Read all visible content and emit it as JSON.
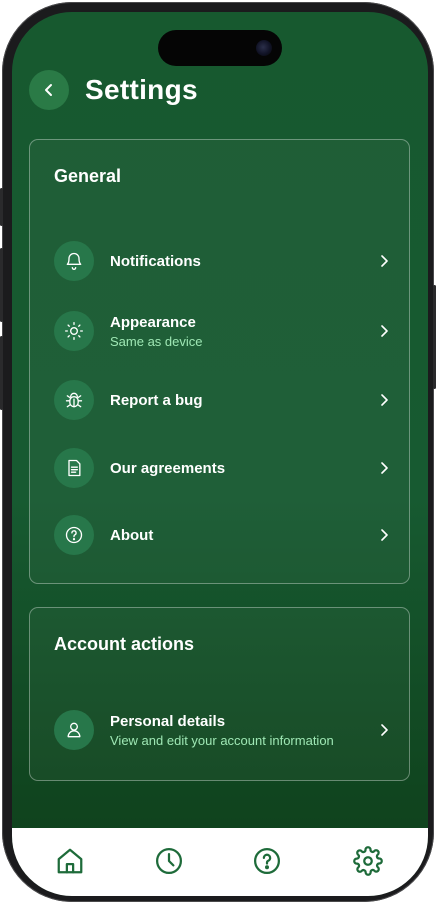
{
  "header": {
    "title": "Settings"
  },
  "general": {
    "title": "General",
    "items": [
      {
        "label": "Notifications",
        "sub": "",
        "icon": "bell-icon"
      },
      {
        "label": "Appearance",
        "sub": "Same as device",
        "icon": "sun-icon"
      },
      {
        "label": "Report a bug",
        "sub": "",
        "icon": "bug-icon"
      },
      {
        "label": "Our agreements",
        "sub": "",
        "icon": "document-icon"
      },
      {
        "label": "About",
        "sub": "",
        "icon": "question-circle-icon"
      }
    ]
  },
  "account": {
    "title": "Account actions",
    "items": [
      {
        "label": "Personal details",
        "sub": "View and edit your account information",
        "icon": "user-icon"
      }
    ]
  },
  "tabbar": {
    "tabs": [
      {
        "icon": "home-icon",
        "active": false
      },
      {
        "icon": "clock-icon",
        "active": false
      },
      {
        "icon": "help-icon",
        "active": false
      },
      {
        "icon": "gear-icon",
        "active": true
      }
    ]
  },
  "colors": {
    "background": "#175a31",
    "icon_circle": "#27774a",
    "subtitle": "#9ee7b4",
    "tab_icon": "#1e6b3a"
  }
}
